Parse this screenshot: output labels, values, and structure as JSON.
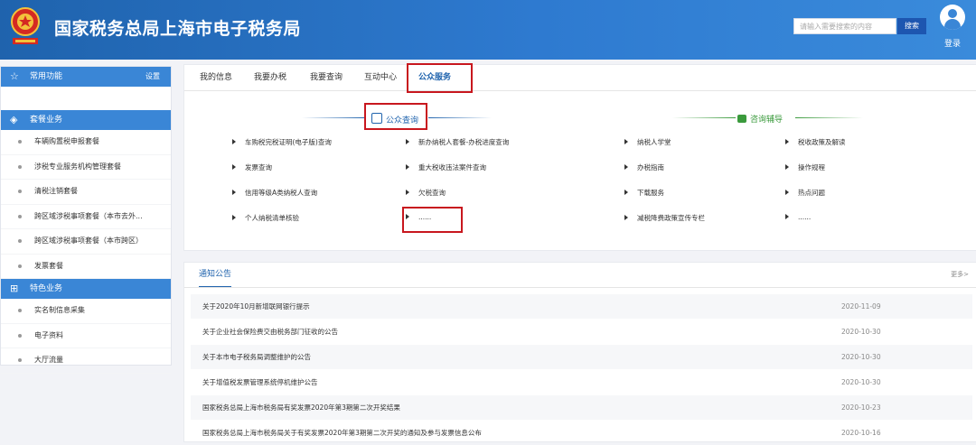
{
  "header": {
    "title": "国家税务总局上海市电子税务局",
    "logo_icon": "tax-emblem-icon",
    "search_placeholder": "请输入需要搜索的内容",
    "search_button": "搜索",
    "login_label": "登录",
    "bg_color": "#2a6fc2"
  },
  "sidebar": {
    "common": {
      "label": "常用功能",
      "settings": "设置",
      "icon": "star-icon"
    },
    "package": {
      "label": "套餐业务",
      "icon": "layers-icon",
      "items": [
        "车辆购置税申报套餐",
        "涉税专业服务机构管理套餐",
        "清税注销套餐",
        "跨区域涉税事项套餐（本市去外...",
        "跨区域涉税事项套餐（本市跨区）",
        "发票套餐"
      ]
    },
    "special": {
      "label": "特色业务",
      "icon": "grid-icon",
      "items": [
        "实名制信息采集",
        "电子资料",
        "大厅流量"
      ]
    }
  },
  "tabs": [
    "我的信息",
    "我要办税",
    "我要查询",
    "互动中心",
    "公众服务"
  ],
  "public_query": {
    "title": "公众查询",
    "col1": [
      "车购税完税证明(电子版)查询",
      "发票查询",
      "信用等级A类纳税人查询",
      "个人纳税清单核验"
    ],
    "col2": [
      "新办纳税人套餐-办税进度查询",
      "重大税收违法案件查询",
      "欠税查询",
      "......"
    ]
  },
  "consult": {
    "title": "咨询辅导",
    "col1": [
      "纳税人学堂",
      "办税指南",
      "下载服务",
      "减税降费政策宣传专栏"
    ],
    "col2": [
      "税收政策及解读",
      "操作规程",
      "热点问题",
      "......"
    ]
  },
  "notice": {
    "tab": "通知公告",
    "more": "更多>",
    "rows": [
      {
        "title": "关于2020年10月新增联网银行提示",
        "date": "2020-11-09"
      },
      {
        "title": "关于企业社会保险费交由税务部门征收的公告",
        "date": "2020-10-30"
      },
      {
        "title": "关于本市电子税务局调整维护的公告",
        "date": "2020-10-30"
      },
      {
        "title": "关于增值税发票管理系统停机维护公告",
        "date": "2020-10-30"
      },
      {
        "title": "国家税务总局上海市税务局有奖发票2020年第3期第二次开奖结果",
        "date": "2020-10-23"
      },
      {
        "title": "国家税务总局上海市税务局关于有奖发票2020年第3期第二次开奖的通知及参与发票信息公布",
        "date": "2020-10-16"
      }
    ]
  },
  "colors": {
    "accent": "#1f63ad",
    "highlight": "#c8171e",
    "consult_green": "#3a9a3c"
  }
}
